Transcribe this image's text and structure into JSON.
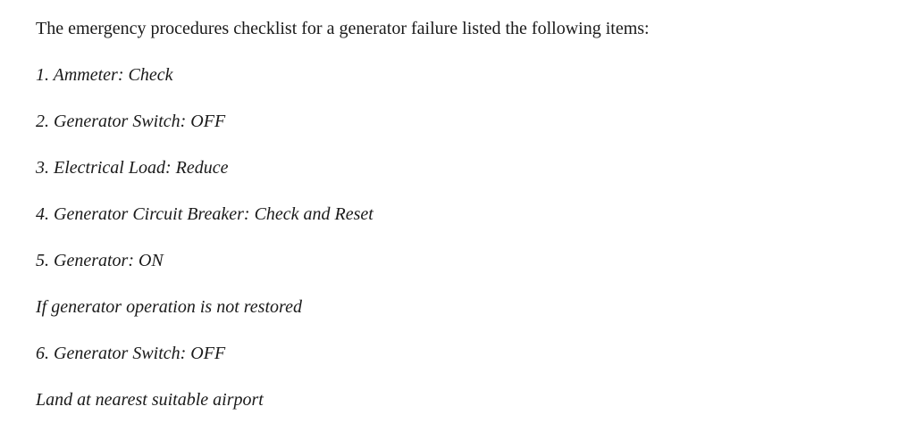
{
  "intro": "The emergency procedures checklist for a generator failure listed the following items:",
  "items": [
    "1. Ammeter: Check",
    "2. Generator Switch: OFF",
    "3. Electrical Load: Reduce",
    "4. Generator Circuit Breaker: Check and Reset",
    "5. Generator: ON"
  ],
  "note1": "If generator operation is not restored",
  "item6": "6. Generator Switch: OFF",
  "note2": "Land at nearest suitable airport"
}
